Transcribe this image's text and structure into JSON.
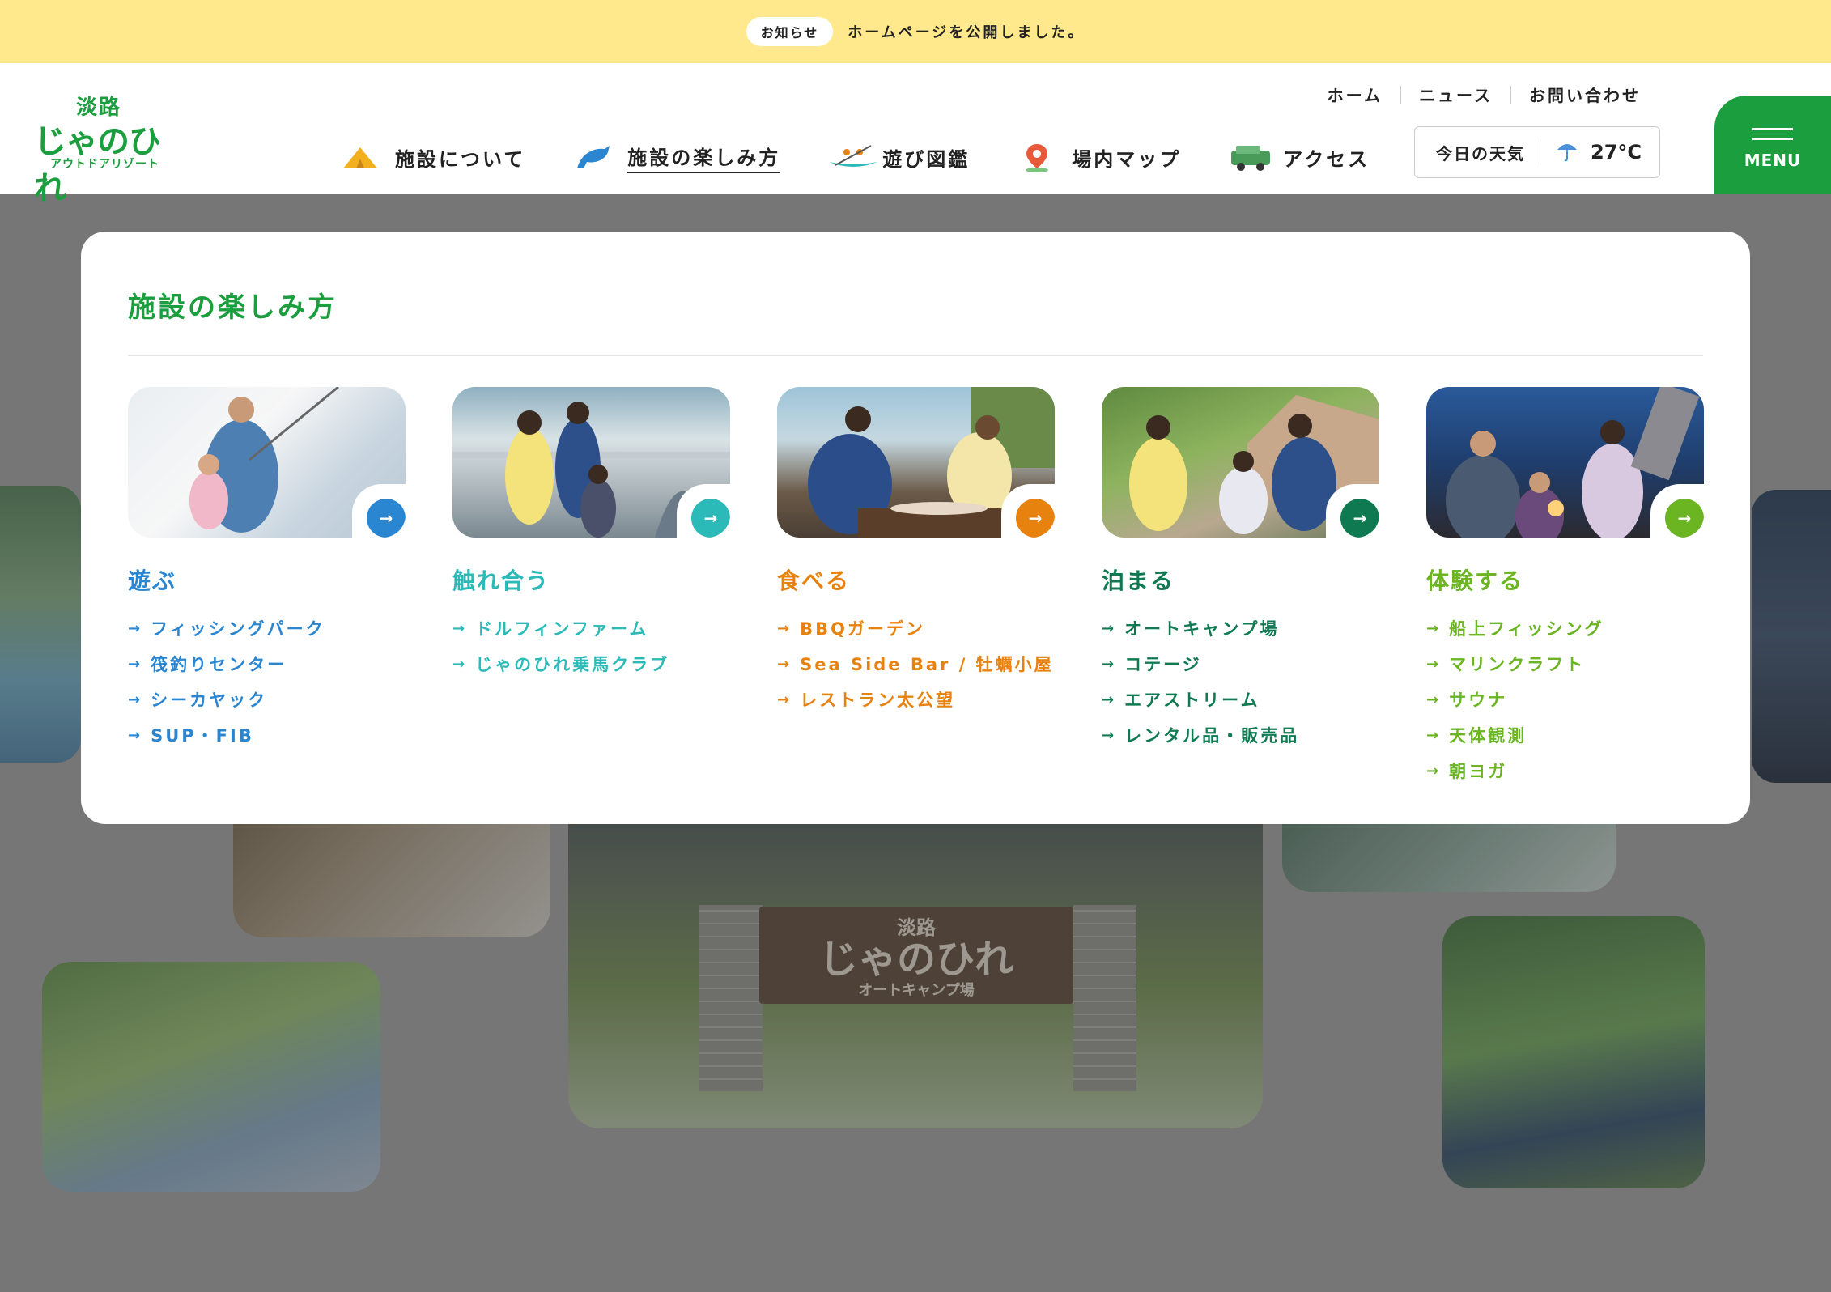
{
  "notice": {
    "badge": "お知らせ",
    "text": "ホームページを公開しました。"
  },
  "logo": {
    "line1": "淡路",
    "line2": "じゃのひれ",
    "line3": "アウトドアリゾート"
  },
  "util_nav": [
    {
      "label": "ホーム"
    },
    {
      "label": "ニュース"
    },
    {
      "label": "お問い合わせ"
    }
  ],
  "main_nav": [
    {
      "label": "施設について",
      "icon": "tent-icon"
    },
    {
      "label": "施設の楽しみ方",
      "icon": "dolphin-icon"
    },
    {
      "label": "遊び図鑑",
      "icon": "canoe-icon"
    },
    {
      "label": "場内マップ",
      "icon": "map-pin-icon"
    },
    {
      "label": "アクセス",
      "icon": "car-icon"
    }
  ],
  "weather": {
    "label": "今日の天気",
    "temp": "27°C",
    "icon": "umbrella-icon"
  },
  "menu_button": {
    "label": "MENU"
  },
  "sign": {
    "line1": "淡路",
    "line2": "じゃのひれ",
    "line3": "オートキャンプ場"
  },
  "panel": {
    "title": "施設の楽しみ方",
    "columns": [
      {
        "title": "遊ぶ",
        "color": "#2a86d1",
        "links": [
          "フィッシングパーク",
          "筏釣りセンター",
          "シーカヤック",
          "SUP・FIB"
        ]
      },
      {
        "title": "触れ合う",
        "color": "#2bbab8",
        "links": [
          "ドルフィンファーム",
          "じゃのひれ乗馬クラブ"
        ]
      },
      {
        "title": "食べる",
        "color": "#e8820e",
        "links": [
          "BBQガーデン",
          "Sea Side Bar / 牡蠣小屋",
          "レストラン太公望"
        ]
      },
      {
        "title": "泊まる",
        "color": "#0f7a52",
        "links": [
          "オートキャンプ場",
          "コテージ",
          "エアストリーム",
          "レンタル品・販売品"
        ]
      },
      {
        "title": "体験する",
        "color": "#6ab521",
        "links": [
          "船上フィッシング",
          "マリンクラフト",
          "サウナ",
          "天体観測",
          "朝ヨガ"
        ]
      }
    ]
  }
}
